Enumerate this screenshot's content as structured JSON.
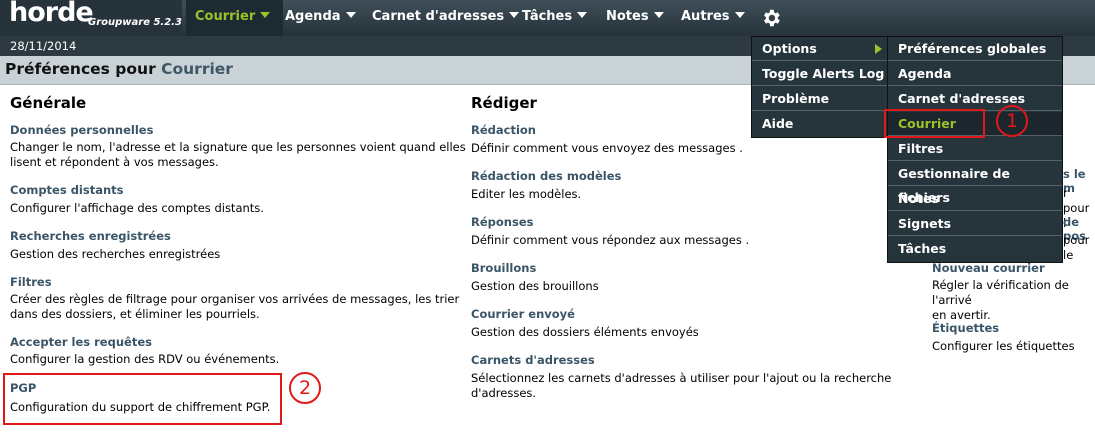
{
  "app": {
    "logo": "horde",
    "logo_subtitle": "Groupware 5.2.3"
  },
  "nav": {
    "items": [
      {
        "label": "Courrier"
      },
      {
        "label": "Agenda"
      },
      {
        "label": "Carnet d'adresses"
      },
      {
        "label": "Tâches"
      },
      {
        "label": "Notes"
      },
      {
        "label": "Autres"
      }
    ],
    "gear_icon": "gear-icon"
  },
  "date": "28/11/2014",
  "page_title": {
    "prefix": "Préférences pour",
    "app": "Courrier"
  },
  "columns": {
    "generale": {
      "heading": "Générale",
      "items": [
        {
          "title": "Données personnelles",
          "desc1": "Changer le nom, l'adresse et la signature que les personnes voient quand elles",
          "desc2": "lisent et répondent à vos messages."
        },
        {
          "title": "Comptes distants",
          "desc1": "Configurer l'affichage des comptes distants."
        },
        {
          "title": "Recherches enregistrées",
          "desc1": "Gestion des recherches enregistrées"
        },
        {
          "title": "Filtres",
          "desc1": "Créer des règles de filtrage pour organiser vos arrivées de messages, les trier",
          "desc2": "dans des dossiers, et éliminer les pourriels."
        },
        {
          "title": "Accepter les requêtes",
          "desc1": "Configurer la gestion des RDV ou événements."
        },
        {
          "title": "PGP",
          "desc1": "Configuration du support de chiffrement PGP."
        }
      ]
    },
    "rediger": {
      "heading": "Rédiger",
      "items": [
        {
          "title": "Rédaction",
          "desc1": "Définir comment vous envoyez des messages ."
        },
        {
          "title": "Rédaction des modèles",
          "desc1": "Editer les modèles."
        },
        {
          "title": "Réponses",
          "desc1": "Définir comment vous répondez aux messages ."
        },
        {
          "title": "Brouillons",
          "desc1": "Gestion des brouillons"
        },
        {
          "title": "Courrier envoyé",
          "desc1": "Gestion des dossiers éléments envoyés"
        },
        {
          "title": "Carnets d'adresses",
          "desc1": "Sélectionnez les carnets d'adresses à utiliser pour l'ajout ou la recherche",
          "desc2": "d'adresses."
        }
      ]
    },
    "third": {
      "partial": [
        "s le m",
        "r pour l",
        "de pos",
        "pour le"
      ],
      "items": [
        {
          "title": "Nouveau courrier",
          "desc1": "Régler la vérification de l'arrivé",
          "desc2": "en avertir."
        },
        {
          "title": "Étiquettes",
          "desc1": "Configurer les étiquettes"
        }
      ]
    }
  },
  "options_menu": {
    "items": [
      "Options",
      "Toggle Alerts Log",
      "Problème",
      "Aide"
    ]
  },
  "submenu": {
    "items": [
      "Préférences globales",
      "Agenda",
      "Carnet d'adresses",
      "Courrier",
      "Filtres",
      "Gestionnaire de fichiers",
      "Notes",
      "Signets",
      "Tâches"
    ]
  },
  "annotations": {
    "one": "1",
    "two": "2"
  },
  "colors": {
    "accent": "#9ec02a",
    "link": "#3a5568",
    "highlight": "#e01818"
  }
}
